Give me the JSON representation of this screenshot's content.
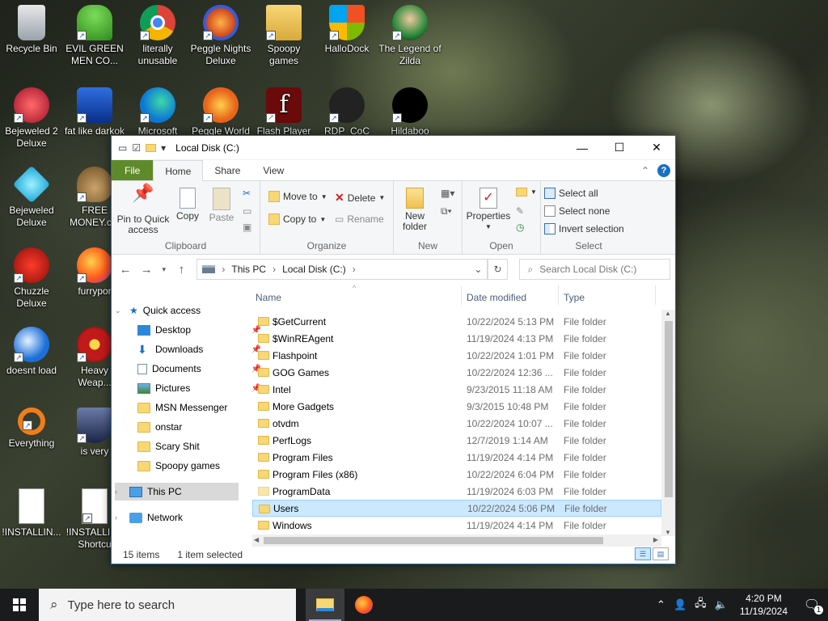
{
  "desktop": {
    "icons": [
      {
        "label": "Recycle Bin"
      },
      {
        "label": "EVIL GREEN MEN CO..."
      },
      {
        "label": "literally unusable"
      },
      {
        "label": "Peggle Nights Deluxe"
      },
      {
        "label": "Spoopy games"
      },
      {
        "label": "HalloDock"
      },
      {
        "label": "The Legend of Zilda"
      },
      {
        "label": "Bejeweled 2 Deluxe"
      },
      {
        "label": "fat like darkok"
      },
      {
        "label": "Microsoft"
      },
      {
        "label": "Peggle World"
      },
      {
        "label": "Flash Player"
      },
      {
        "label": "RDP_CoC"
      },
      {
        "label": "Hildaboo"
      },
      {
        "label": "Bejeweled Deluxe"
      },
      {
        "label": "FREE MONEY.c..."
      },
      {
        "label": "Chuzzle Deluxe"
      },
      {
        "label": "furrypor"
      },
      {
        "label": "doesnt load"
      },
      {
        "label": "Heavy Weap..."
      },
      {
        "label": "Everything"
      },
      {
        "label": "is very"
      },
      {
        "label": "!INSTALLIN..."
      },
      {
        "label": "!INSTALLIN - Shortcu"
      }
    ]
  },
  "window": {
    "title": "Local Disk (C:)",
    "tabs": {
      "file": "File",
      "home": "Home",
      "share": "Share",
      "view": "View"
    },
    "ribbon": {
      "clipboard": {
        "label": "Clipboard",
        "pin": "Pin to Quick access",
        "copy": "Copy",
        "paste": "Paste"
      },
      "organize": {
        "label": "Organize",
        "move_to": "Move to",
        "copy_to": "Copy to",
        "delete": "Delete",
        "rename": "Rename"
      },
      "new": {
        "label": "New",
        "new_folder": "New folder"
      },
      "open": {
        "label": "Open",
        "properties": "Properties"
      },
      "select": {
        "label": "Select",
        "select_all": "Select all",
        "select_none": "Select none",
        "invert": "Invert selection"
      }
    },
    "address": {
      "crumbs": [
        "This PC",
        "Local Disk (C:)"
      ]
    },
    "search": {
      "placeholder": "Search Local Disk (C:)"
    },
    "nav": {
      "quick_access": "Quick access",
      "items": [
        {
          "label": "Desktop",
          "pinned": true
        },
        {
          "label": "Downloads",
          "pinned": true
        },
        {
          "label": "Documents",
          "pinned": true
        },
        {
          "label": "Pictures",
          "pinned": true
        },
        {
          "label": "MSN Messenger"
        },
        {
          "label": "onstar"
        },
        {
          "label": "Scary Shit"
        },
        {
          "label": "Spoopy games"
        }
      ],
      "this_pc": "This PC",
      "network": "Network"
    },
    "columns": {
      "name": "Name",
      "date": "Date modified",
      "type": "Type"
    },
    "files": [
      {
        "name": "$GetCurrent",
        "date": "10/22/2024 5:13 PM",
        "type": "File folder"
      },
      {
        "name": "$WinREAgent",
        "date": "11/19/2024 4:13 PM",
        "type": "File folder"
      },
      {
        "name": "Flashpoint",
        "date": "10/22/2024 1:01 PM",
        "type": "File folder"
      },
      {
        "name": "GOG Games",
        "date": "10/22/2024 12:36 ...",
        "type": "File folder"
      },
      {
        "name": "Intel",
        "date": "9/23/2015 11:18 AM",
        "type": "File folder"
      },
      {
        "name": "More Gadgets",
        "date": "9/3/2015 10:48 PM",
        "type": "File folder"
      },
      {
        "name": "otvdm",
        "date": "10/22/2024 10:07 ...",
        "type": "File folder"
      },
      {
        "name": "PerfLogs",
        "date": "12/7/2019 1:14 AM",
        "type": "File folder"
      },
      {
        "name": "Program Files",
        "date": "11/19/2024 4:14 PM",
        "type": "File folder"
      },
      {
        "name": "Program Files (x86)",
        "date": "10/22/2024 6:04 PM",
        "type": "File folder"
      },
      {
        "name": "ProgramData",
        "date": "11/19/2024 6:03 PM",
        "type": "File folder"
      },
      {
        "name": "Users",
        "date": "10/22/2024 5:06 PM",
        "type": "File folder",
        "selected": true
      },
      {
        "name": "Windows",
        "date": "11/19/2024 4:14 PM",
        "type": "File folder"
      }
    ],
    "status": {
      "count": "15 items",
      "selected": "1 item selected"
    }
  },
  "taskbar": {
    "search_placeholder": "Type here to search",
    "time": "4:20 PM",
    "date": "11/19/2024",
    "notification_count": "1"
  },
  "colors": {
    "accent": "#1a6fc4",
    "file_tab": "#5f8a2c",
    "selection": "#cce8ff",
    "folder": "#f8d775"
  }
}
